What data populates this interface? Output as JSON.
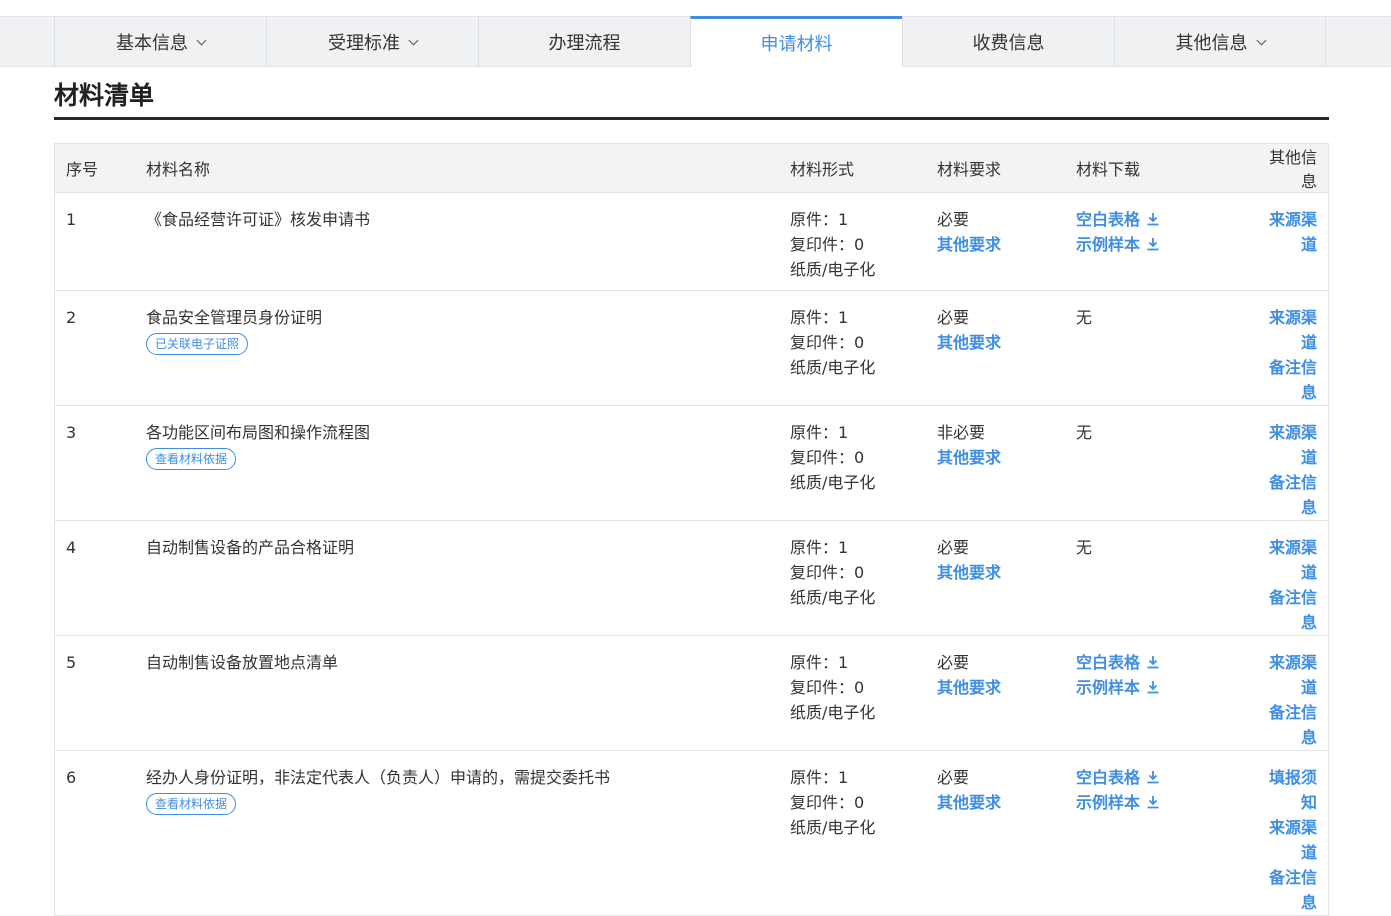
{
  "tabs": [
    {
      "label": "基本信息",
      "dropdown": true
    },
    {
      "label": "受理标准",
      "dropdown": true
    },
    {
      "label": "办理流程",
      "dropdown": false
    },
    {
      "label": "申请材料",
      "dropdown": false,
      "active": true
    },
    {
      "label": "收费信息",
      "dropdown": false
    },
    {
      "label": "其他信息",
      "dropdown": true
    }
  ],
  "section_title": "材料清单",
  "headers": {
    "no": "序号",
    "name": "材料名称",
    "form": "材料形式",
    "req": "材料要求",
    "download": "材料下载",
    "other": "其他信息"
  },
  "rows": [
    {
      "no": "1",
      "name": "《食品经营许可证》核发申请书",
      "tag": "",
      "form": [
        "原件：1",
        "复印件：0",
        "纸质/电子化"
      ],
      "req": "必要",
      "req_link": "其他要求",
      "downloads": [
        "空白表格",
        "示例样本"
      ],
      "none": "",
      "other": [
        "来源渠道"
      ]
    },
    {
      "no": "2",
      "name": "食品安全管理员身份证明",
      "tag": "已关联电子证照",
      "form": [
        "原件：1",
        "复印件：0",
        "纸质/电子化"
      ],
      "req": "必要",
      "req_link": "其他要求",
      "downloads": [],
      "none": "无",
      "other": [
        "来源渠道",
        "备注信息"
      ]
    },
    {
      "no": "3",
      "name": "各功能区间布局图和操作流程图",
      "tag": "查看材料依据",
      "form": [
        "原件：1",
        "复印件：0",
        "纸质/电子化"
      ],
      "req": "非必要",
      "req_link": "其他要求",
      "downloads": [],
      "none": "无",
      "other": [
        "来源渠道",
        "备注信息"
      ]
    },
    {
      "no": "4",
      "name": "自动制售设备的产品合格证明",
      "tag": "",
      "form": [
        "原件：1",
        "复印件：0",
        "纸质/电子化"
      ],
      "req": "必要",
      "req_link": "其他要求",
      "downloads": [],
      "none": "无",
      "other": [
        "来源渠道",
        "备注信息"
      ]
    },
    {
      "no": "5",
      "name": "自动制售设备放置地点清单",
      "tag": "",
      "form": [
        "原件：1",
        "复印件：0",
        "纸质/电子化"
      ],
      "req": "必要",
      "req_link": "其他要求",
      "downloads": [
        "空白表格",
        "示例样本"
      ],
      "none": "",
      "other": [
        "来源渠道",
        "备注信息"
      ]
    },
    {
      "no": "6",
      "name": "经办人身份证明，非法定代表人（负责人）申请的，需提交委托书",
      "tag": "查看材料依据",
      "form": [
        "原件：1",
        "复印件：0",
        "纸质/电子化"
      ],
      "req": "必要",
      "req_link": "其他要求",
      "downloads": [
        "空白表格",
        "示例样本"
      ],
      "none": "",
      "other": [
        "填报须知",
        "来源渠道",
        "备注信息"
      ]
    }
  ],
  "colors": {
    "accent": "#3f8ee6",
    "rule": "#1f2a36"
  },
  "icons": {
    "download": "download-icon",
    "dropdown": "chevron-down-icon"
  }
}
